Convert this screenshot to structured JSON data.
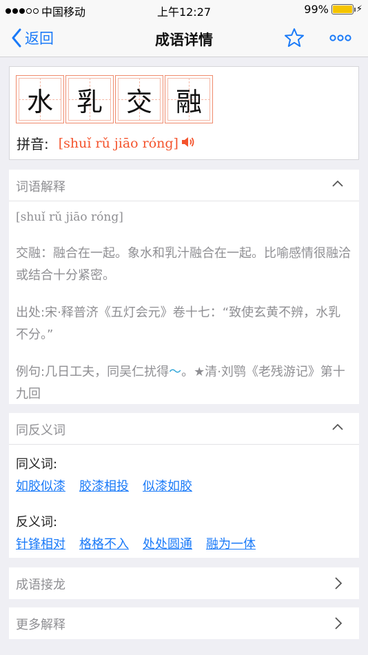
{
  "status_bar": {
    "carrier": "中国移动",
    "time": "上午12:27",
    "battery": "99%",
    "battery_level": 0.99
  },
  "nav": {
    "back_label": "返回",
    "title": "成语详情",
    "favorite_icon": "star-icon",
    "more_icon": "more-dots-icon"
  },
  "idiom": {
    "chars": [
      "水",
      "乳",
      "交",
      "融"
    ],
    "pinyin_label": "拼音:",
    "pinyin": "[shuǐ rǔ jiāo róng]"
  },
  "explanation": {
    "section_title": "词语解释",
    "pinyin": "[shuǐ rǔ jiāo róng]",
    "meaning": "交融：融合在一起。象水和乳汁融合在一起。比喻感情很融洽或结合十分紧密。",
    "source": "出处:宋·释普济《五灯会元》卷十七：“致使玄黄不辨，水乳不分。”",
    "example_prefix": "例句:几日工夫，同吴仁扰得",
    "example_tilde": "～",
    "example_suffix": "。★清·刘鹗《老残游记》第十九回"
  },
  "synonyms": {
    "section_title": "同反义词",
    "syn_label": "同义词:",
    "syn": [
      "如胶似漆",
      "胶漆相投",
      "似漆如胶"
    ],
    "ant_label": "反义词:",
    "ant": [
      "针锋相对",
      "格格不入",
      "处处圆通",
      "融为一体"
    ]
  },
  "links": {
    "chain": "成语接龙",
    "more": "更多解释"
  },
  "colors": {
    "accent": "#1a7af8",
    "pinyin": "#f4532c",
    "grid": "#ef8a6c",
    "battery": "#f5c400"
  }
}
